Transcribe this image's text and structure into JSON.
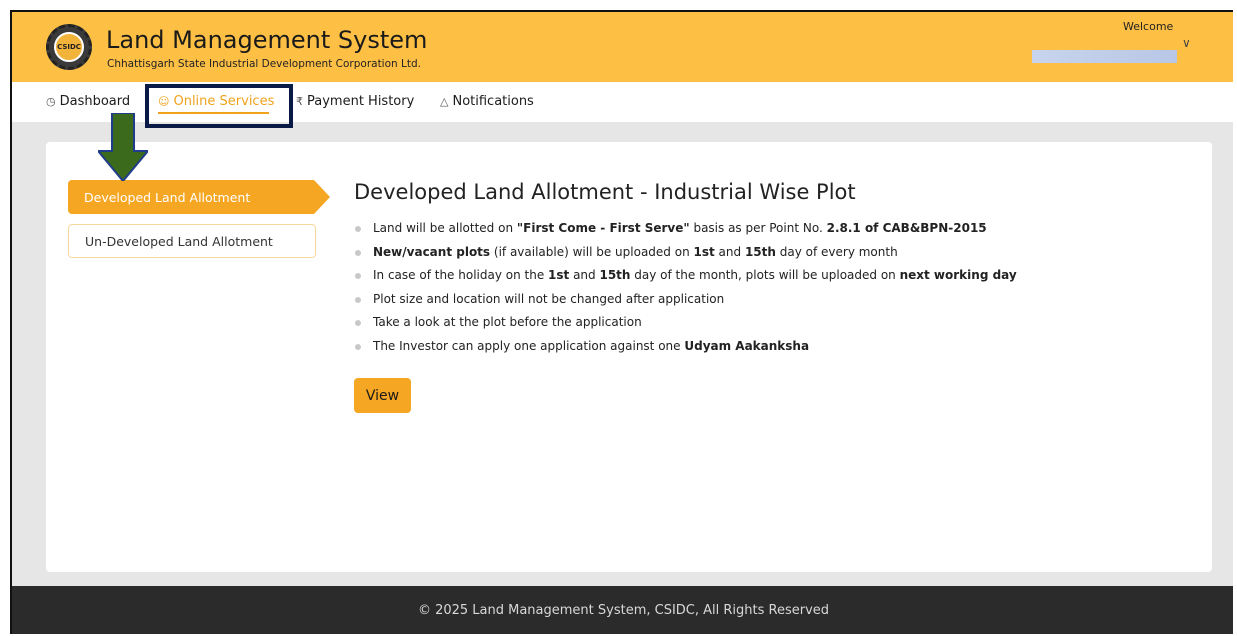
{
  "header": {
    "logo_text": "CSIDC",
    "title": "Land Management System",
    "subtitle": "Chhattisgarh State Industrial Development Corporation Ltd.",
    "welcome_label": "Welcome",
    "chevron": "∨"
  },
  "nav": {
    "items": [
      {
        "icon": "◷",
        "label": "Dashboard"
      },
      {
        "icon": "☺",
        "label": "Online Services"
      },
      {
        "icon": "₹",
        "label": "Payment History"
      },
      {
        "icon": "△",
        "label": "Notifications"
      }
    ],
    "active_index": 1
  },
  "sidebar": {
    "tabs": [
      {
        "label": "Developed Land Allotment"
      },
      {
        "label": "Un-Developed Land Allotment"
      }
    ]
  },
  "main": {
    "title": "Developed Land Allotment - Industrial Wise Plot",
    "bullets": [
      {
        "parts": [
          {
            "t": "Land will be allotted on "
          },
          {
            "t": "\"First Come - First Serve\"",
            "b": true
          },
          {
            "t": " basis as per Point No. "
          },
          {
            "t": "2.8.1 of CAB&BPN-2015",
            "b": true
          }
        ]
      },
      {
        "parts": [
          {
            "t": "New/vacant plots",
            "b": true
          },
          {
            "t": " (if available) will be uploaded on "
          },
          {
            "t": "1st",
            "b": true
          },
          {
            "t": " and "
          },
          {
            "t": "15th",
            "b": true
          },
          {
            "t": " day of every month"
          }
        ]
      },
      {
        "parts": [
          {
            "t": "In case of the holiday on the "
          },
          {
            "t": "1st",
            "b": true
          },
          {
            "t": " and "
          },
          {
            "t": "15th",
            "b": true
          },
          {
            "t": " day of the month, plots will be uploaded on "
          },
          {
            "t": "next working day",
            "b": true
          }
        ]
      },
      {
        "parts": [
          {
            "t": "Plot size and location will not be changed after application"
          }
        ]
      },
      {
        "parts": [
          {
            "t": "Take a look at the plot before the application"
          }
        ]
      },
      {
        "parts": [
          {
            "t": "The Investor can apply one application against one "
          },
          {
            "t": "Udyam Aakanksha",
            "b": true
          }
        ]
      }
    ],
    "view_label": "View"
  },
  "footer": {
    "text": "© 2025 Land Management System, CSIDC, All Rights Reserved"
  },
  "colors": {
    "accent": "#f5a623",
    "header_bg": "#fec044",
    "footer_bg": "#2b2b2b",
    "annotation_box": "#0a1a46",
    "annotation_arrow": "#3b6a1c"
  }
}
